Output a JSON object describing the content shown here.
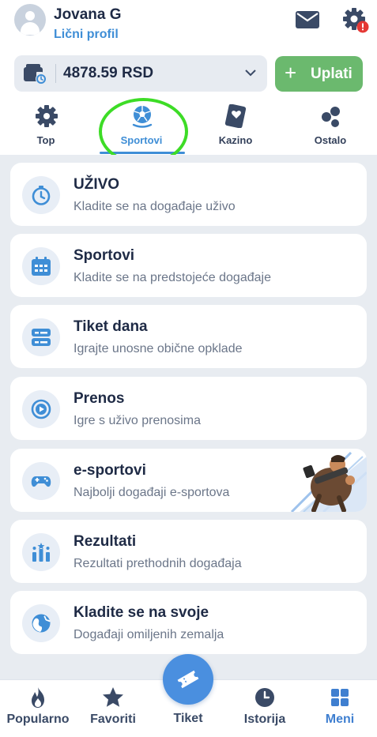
{
  "header": {
    "user_name": "Jovana G",
    "profile_link": "Lični profil"
  },
  "balance": {
    "amount": "4878.59 RSD",
    "deposit_label": "Uplati",
    "deposit_plus": "+"
  },
  "tabs": [
    {
      "label": "Top",
      "icon": "gear-badge-icon"
    },
    {
      "label": "Sportovi",
      "icon": "soccer-ball-icon",
      "active": true
    },
    {
      "label": "Kazino",
      "icon": "playing-card-icon"
    },
    {
      "label": "Ostalo",
      "icon": "dots-cluster-icon"
    }
  ],
  "cards": [
    {
      "title": "UŽIVO",
      "subtitle": "Kladite se na događaje uživo",
      "icon": "stopwatch-icon"
    },
    {
      "title": "Sportovi",
      "subtitle": "Kladite se na predstojeće događaje",
      "icon": "calendar-icon"
    },
    {
      "title": "Tiket dana",
      "subtitle": "Igrajte unosne obične opklade",
      "icon": "ticket-list-icon"
    },
    {
      "title": "Prenos",
      "subtitle": "Igre s uživo prenosima",
      "icon": "play-circle-icon"
    },
    {
      "title": "e-sportovi",
      "subtitle": "Najbolji događaji e-sportova",
      "icon": "gamepad-icon"
    },
    {
      "title": "Rezultati",
      "subtitle": "Rezultati prethodnih događaja",
      "icon": "results-bars-icon"
    },
    {
      "title": "Kladite se na svoje",
      "subtitle": "Događaji omiljenih zemalja",
      "icon": "globe-icon"
    }
  ],
  "bottom_nav": {
    "popular": "Popularno",
    "favorites": "Favoriti",
    "ticket": "Tiket",
    "history": "Istorija",
    "menu": "Meni"
  },
  "colors": {
    "accent_blue": "#3f8ed6",
    "deposit_green": "#6bb96e",
    "highlight_ring": "#3ddc26",
    "background_gray": "#e8ecf1",
    "alert_red": "#e53935"
  }
}
